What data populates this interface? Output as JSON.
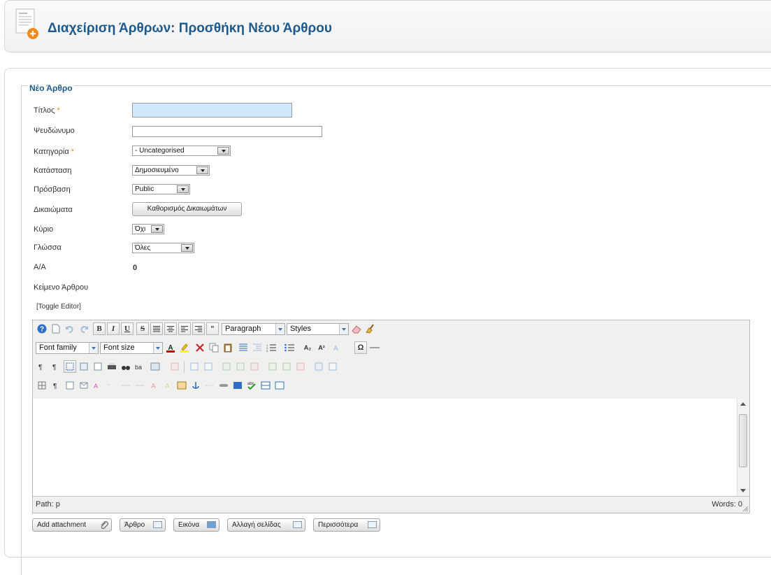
{
  "header": {
    "title": "Διαχείριση Άρθρων: Προσθήκη Νέου Άρθρου"
  },
  "form": {
    "legend": "Νέο Άρθρο",
    "required_mark": "*",
    "title_label": "Τίτλος",
    "title_value": "",
    "alias_label": "Ψευδώνυμο",
    "alias_value": "",
    "category_label": "Κατηγορία",
    "category_value": "- Uncategorised",
    "status_label": "Κατάσταση",
    "status_value": "Δημοσιευμένο",
    "access_label": "Πρόσβαση",
    "access_value": "Public",
    "permissions_label": "Δικαιώματα",
    "permissions_button": "Καθορισμός Δικαιωμάτων",
    "featured_label": "Κύριο",
    "featured_value": "Όχι",
    "language_label": "Γλώσσα",
    "language_value": "Όλες",
    "id_label": "Α/Α",
    "id_value": "0",
    "text_label": "Κείμενο Άρθρου",
    "toggle_editor": "[Toggle Editor]"
  },
  "editor": {
    "format_select": "Paragraph",
    "styles_select": "Styles",
    "font_family_select": "Font family",
    "font_size_select": "Font size",
    "path_text": "Path: p",
    "words_text": "Words: 0",
    "icons": {
      "help": "help-icon",
      "new": "new-document-icon",
      "undo": "undo-icon",
      "redo": "redo-icon",
      "bold": "B",
      "italic": "I",
      "underline": "U",
      "strike": "S",
      "quote": "“",
      "omega": "Ω",
      "sub": "A₂",
      "sup": "A²",
      "find": "binoculars-icon",
      "spell": "abc"
    }
  },
  "buttons": {
    "add_attachment": "Add attachment",
    "article": "Άρθρο",
    "image": "Εικόνα",
    "pagebreak": "Αλλαγή σελίδας",
    "readmore": "Περισσότερα"
  },
  "colors": {
    "title_blue": "#1d5a8b",
    "required_orange": "#e98a1c",
    "title_input_bg": "#cfe8fb"
  }
}
